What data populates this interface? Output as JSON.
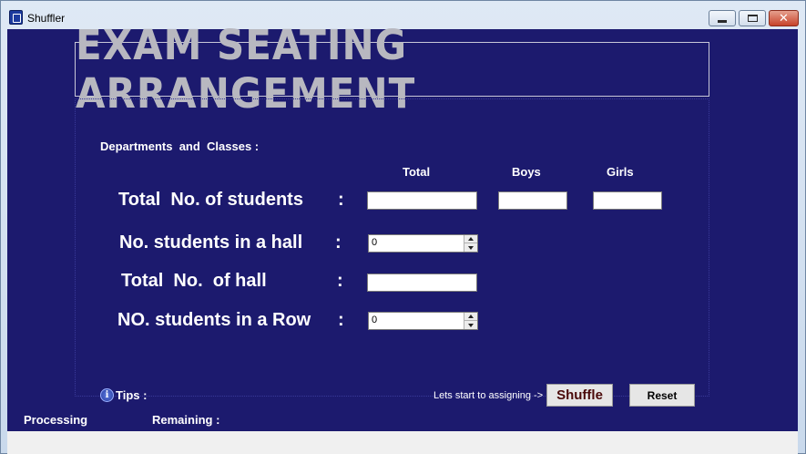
{
  "window": {
    "title": "Shuffler",
    "app_icon": "shuffler-app-icon",
    "controls": {
      "minimize_icon": "minimize-icon",
      "maximize_icon": "maximize-icon",
      "close_glyph": "✕"
    }
  },
  "banner": {
    "title": "Exam Seating Arrangement"
  },
  "form": {
    "section_label": "Departments  and  Classes :",
    "column_headers": {
      "total": "Total",
      "boys": "Boys",
      "girls": "Girls"
    },
    "rows": {
      "total_students": {
        "label": "Total  No. of students",
        "colon": ":",
        "total": "",
        "boys": "",
        "girls": ""
      },
      "students_in_hall": {
        "label": "No. students in a hall",
        "colon": ":",
        "value": "0"
      },
      "total_halls": {
        "label": "Total  No.  of hall",
        "colon": ":",
        "value": ""
      },
      "students_in_row": {
        "label": "NO. students in a Row",
        "colon": ":",
        "value": "0"
      }
    }
  },
  "footer": {
    "tips_label": "Tips :",
    "tips_icon": "info-icon",
    "prompt": "Lets start to assigning ->",
    "shuffle_label": "Shuffle",
    "reset_label": "Reset",
    "processing_label": "Processing",
    "remaining_label": "Remaining :"
  },
  "colors": {
    "background": "#1c1a6e",
    "banner_text": "#b8b8c0",
    "shuffle_text": "#4a0a0a",
    "foreground": "#ffffff"
  }
}
